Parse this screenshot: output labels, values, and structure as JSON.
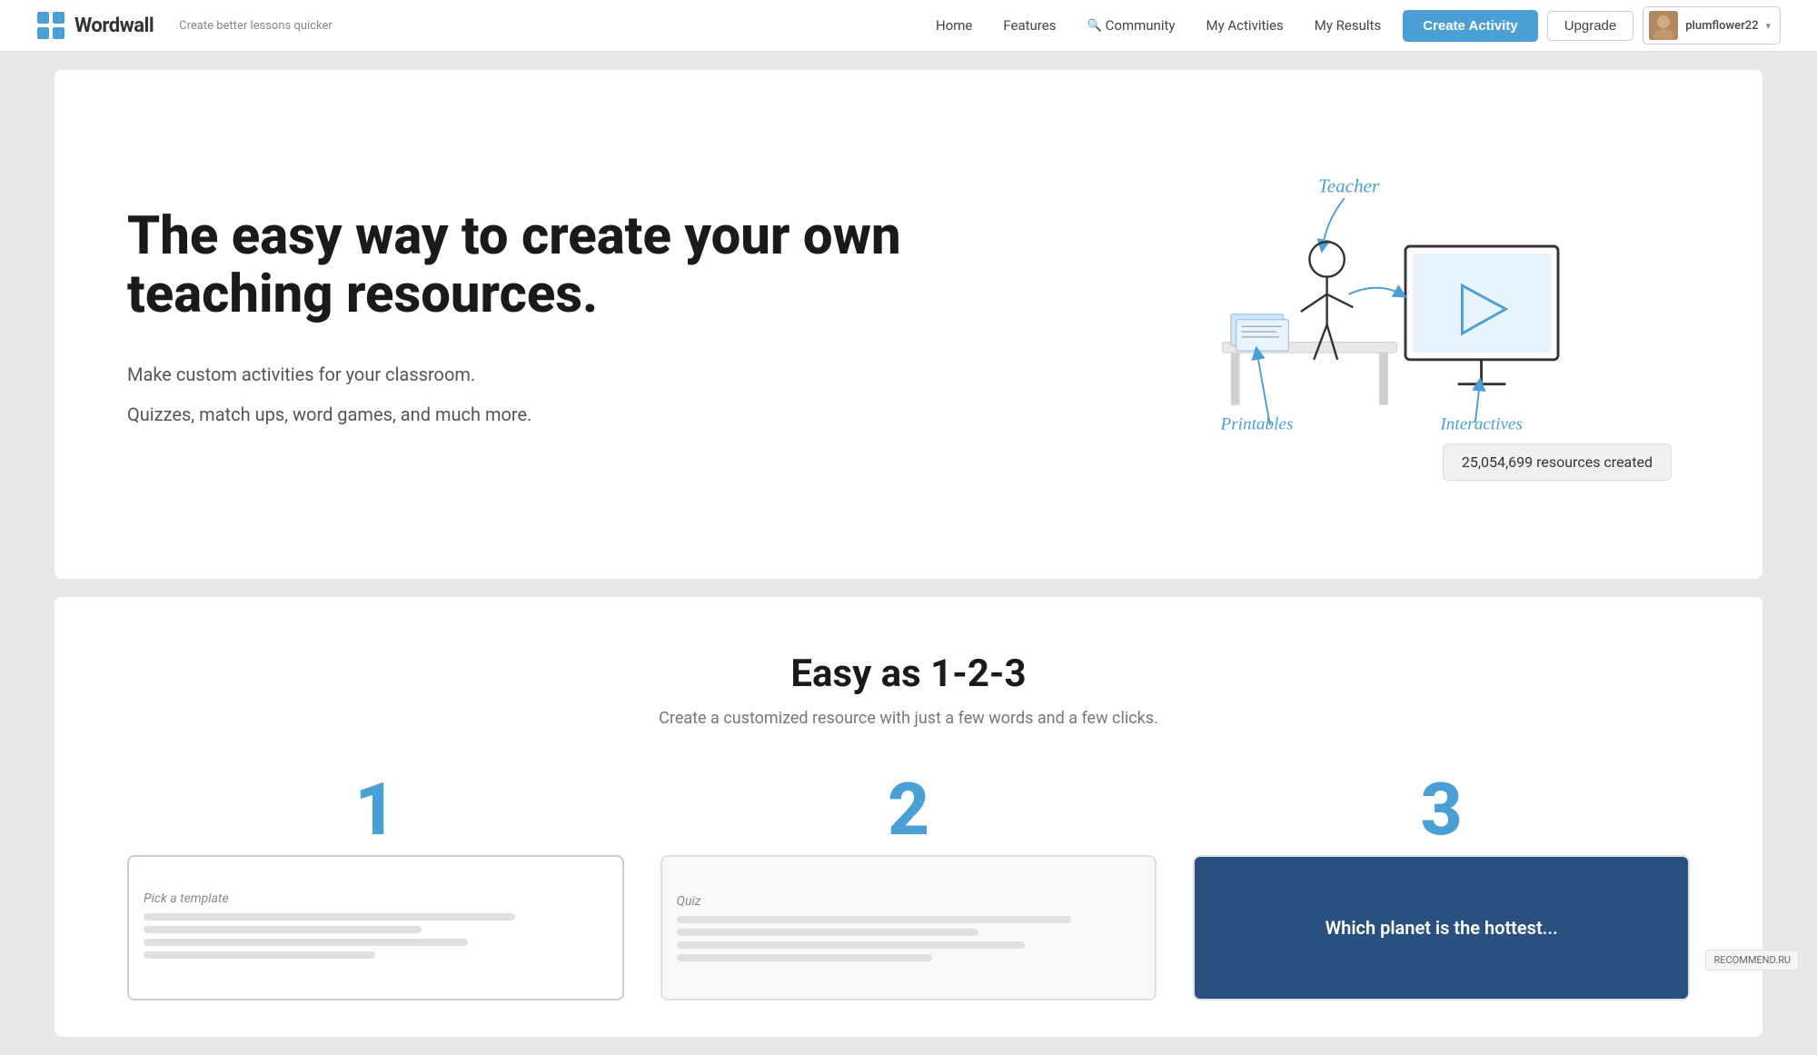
{
  "brand": {
    "logo_alt": "Wordwall logo",
    "name": "Wordwall",
    "tagline": "Create better lessons quicker"
  },
  "nav": {
    "home_label": "Home",
    "features_label": "Features",
    "community_label": "Community",
    "my_activities_label": "My Activities",
    "my_results_label": "My Results",
    "create_activity_label": "Create Activity",
    "upgrade_label": "Upgrade",
    "user_name": "plumflower22",
    "chevron": "▾"
  },
  "hero": {
    "title": "The easy way to create your own teaching resources.",
    "subtitle1": "Make custom activities for your classroom.",
    "subtitle2": "Quizzes, match ups, word games, and much more.",
    "resources_count": "25,054,699 resources created",
    "illustration_teacher_label": "Teacher",
    "illustration_printables_label": "Printables",
    "illustration_interactives_label": "Interactives"
  },
  "easy_section": {
    "title": "Easy as 1-2-3",
    "subtitle": "Create a customized resource with just a few words and a few clicks.",
    "step1_number": "1",
    "step1_label": "Pick a template",
    "step2_number": "2",
    "step2_label": "Quiz",
    "step3_number": "3",
    "step3_question": "Which planet is the hottest..."
  },
  "recommend_badge": "RECOMMEND.RU"
}
